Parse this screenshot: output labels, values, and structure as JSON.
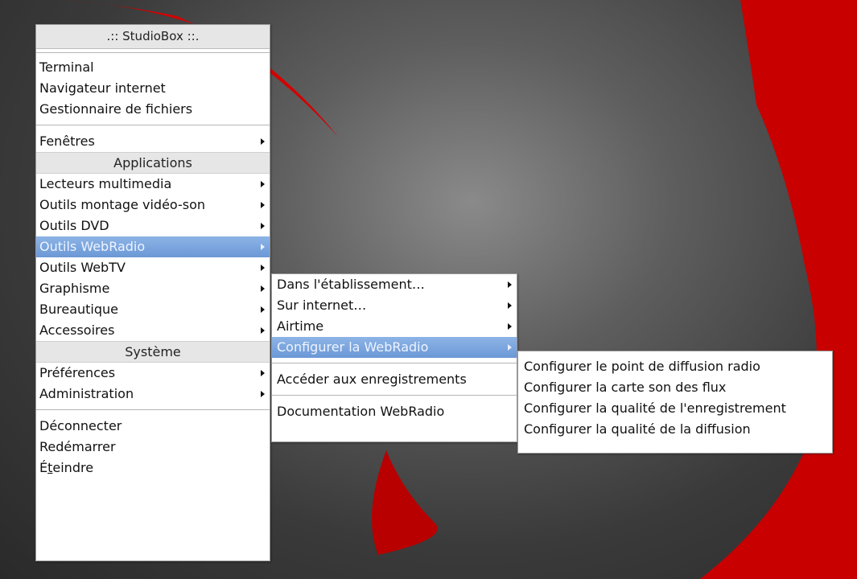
{
  "main_menu": {
    "title": ".:: StudioBox ::.",
    "quick_items": [
      "Terminal",
      "Navigateur internet",
      "Gestionnaire de fichiers"
    ],
    "fenetres": "Fenêtres",
    "applications_header": "Applications",
    "applications": [
      "Lecteurs multimedia",
      "Outils montage vidéo-son",
      "Outils DVD",
      "Outils WebRadio",
      "Outils WebTV",
      "Graphisme",
      "Bureautique",
      "Accessoires"
    ],
    "systeme_header": "Système",
    "systeme": [
      "Préférences",
      "Administration"
    ],
    "session": {
      "logout": "Déconnecter",
      "reboot": "Redémarrer",
      "shutdown_letter1": "É",
      "shutdown_mnemonic": "t",
      "shutdown_rest": "eindre"
    }
  },
  "webradio_menu": {
    "items": [
      "Dans l'établissement…",
      "Sur internet…",
      "Airtime",
      "Configurer la WebRadio"
    ],
    "access": "Accéder aux enregistrements",
    "doc": "Documentation WebRadio"
  },
  "config_menu": {
    "items": [
      "Configurer le point de diffusion radio",
      "Configurer la carte son des flux",
      "Configurer la qualité de l'enregistrement",
      "Configurer la qualité de la diffusion"
    ]
  },
  "colors": {
    "selection": "#6b98d6",
    "wallpaper_accent": "#d40000"
  }
}
